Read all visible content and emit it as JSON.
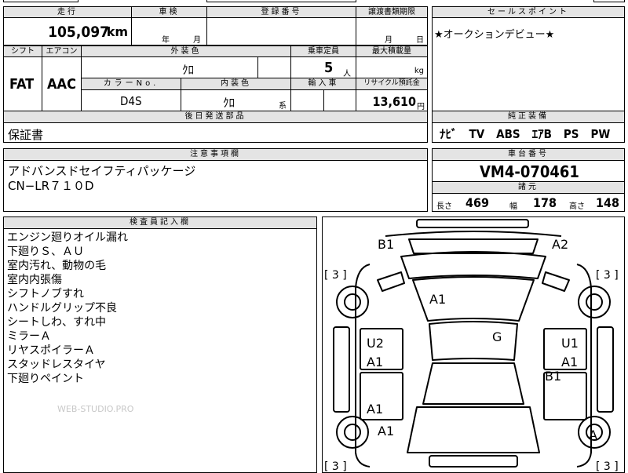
{
  "mileage": {
    "label": "走行",
    "value": "105,097",
    "unit": "km"
  },
  "inspection": {
    "label": "車検",
    "year_unit": "年",
    "month_unit": "月"
  },
  "registration": {
    "label": "登録番号"
  },
  "transfer_deadline": {
    "label": "譲渡書類期限",
    "month_unit": "月",
    "day_unit": "日"
  },
  "sales_point": {
    "label": "セールスポイント",
    "text": "★オークションデビュー★"
  },
  "shift": {
    "label": "シフト",
    "value": "FAT"
  },
  "aircon": {
    "label": "エアコン",
    "value": "AAC"
  },
  "exterior_color": {
    "label": "外装色",
    "value": "ｸﾛ"
  },
  "capacity": {
    "label": "乗車定員",
    "value": "5",
    "unit": "人"
  },
  "max_load": {
    "label": "最大積載量",
    "unit": "kg"
  },
  "color_no": {
    "label": "カラーNo.",
    "value": "D4S"
  },
  "interior_color": {
    "label": "内装色",
    "value": "ｸﾛ",
    "suffix": "系"
  },
  "import": {
    "label": "輸入車"
  },
  "recycle": {
    "label": "リサイクル預託金",
    "value": "13,610",
    "unit": "円"
  },
  "parts": {
    "label": "後日発送部品",
    "value": "保証書"
  },
  "equipment": {
    "label": "純正装備",
    "value": "ﾅﾋﾞ　TV　ABS　ｴｱB　PS　PW"
  },
  "notes": {
    "label": "注意事項欄",
    "lines": [
      "アドバンスドセイフティパッケージ",
      "CN−LR７１０D"
    ]
  },
  "chassis": {
    "label": "車台番号",
    "value": "VM4-070461"
  },
  "specs": {
    "label": "諸元",
    "length_label": "長さ",
    "length": "469",
    "width_label": "幅",
    "width": "178",
    "height_label": "高さ",
    "height": "148"
  },
  "inspector": {
    "label": "検査員記入欄",
    "lines": [
      "エンジン廻りオイル漏れ",
      "下廻りＳ、ＡＵ",
      "室内汚れ、動物の毛",
      "室内内張傷",
      "シフトノブすれ",
      "ハンドルグリップ不良",
      "シートしわ、すれ中",
      "ミラーＡ",
      "リヤスポイラーＡ",
      "スタッドレスタイヤ",
      "下廻りペイント"
    ],
    "watermark": "WEB-STUDIO.PRO"
  },
  "diagram": {
    "marks": {
      "front_left": "B1",
      "front_right": "A2",
      "tire_fl": "[ 3 ]",
      "tire_fr": "[ 3 ]",
      "tire_rl": "[ 3 ]",
      "tire_rr": "[ 3 ]",
      "windshield": "A1",
      "roof": "G",
      "left_front_door_u": "U2",
      "left_front_door_a": "A1",
      "right_front_door_u": "U1",
      "right_front_door_a": "A1",
      "right_side_b": "B1",
      "left_rear_door": "A1",
      "left_rear_fender": "A1",
      "right_rear_wheel": "A"
    }
  }
}
